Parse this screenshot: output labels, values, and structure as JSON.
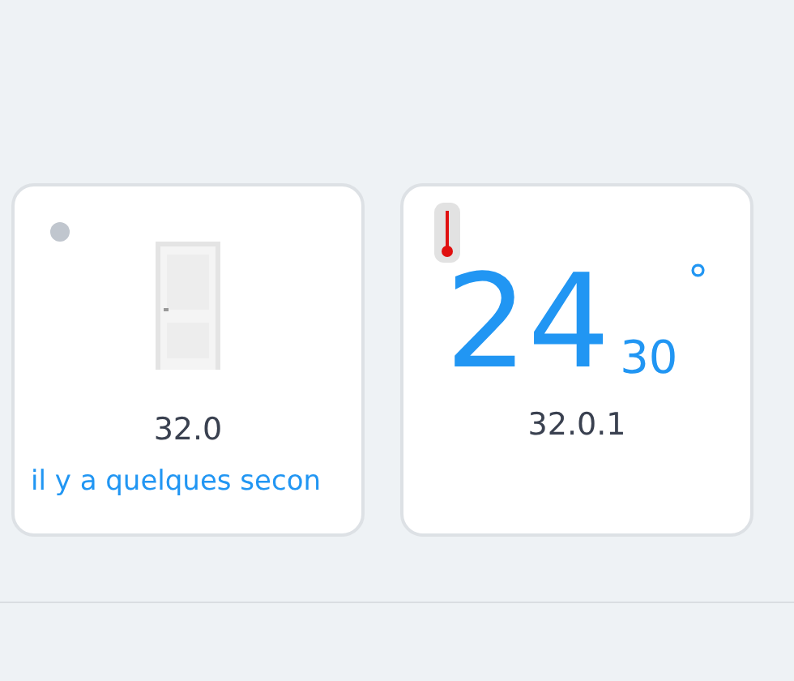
{
  "devices": [
    {
      "kind": "door",
      "active": false,
      "name": "32.0",
      "time": "il y a quelques secon"
    },
    {
      "kind": "thermometer",
      "whole": "24",
      "fraction": "30",
      "unit": "°",
      "name": "32.0.1"
    }
  ]
}
